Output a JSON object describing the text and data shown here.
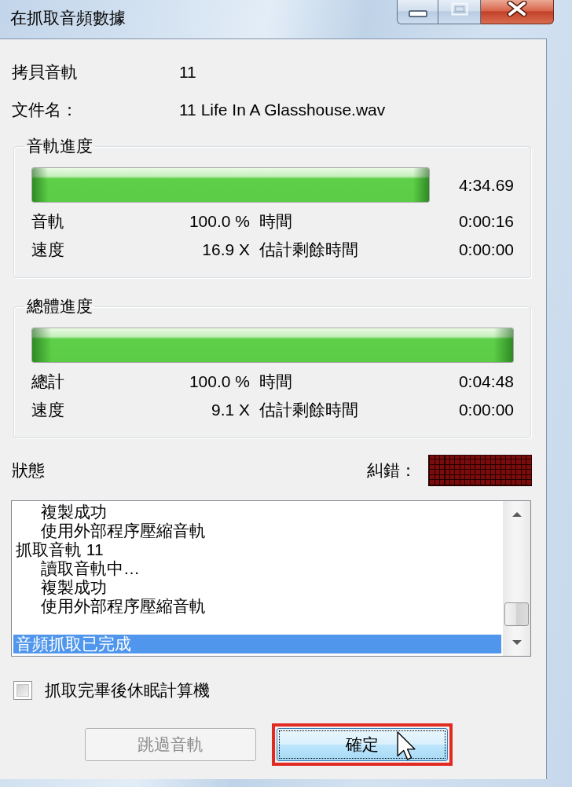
{
  "window": {
    "title": "在抓取音頻數據",
    "buttons": [
      {
        "kind": "minimize",
        "disabled": false
      },
      {
        "kind": "maximize",
        "disabled": true
      },
      {
        "kind": "close",
        "disabled": false
      }
    ]
  },
  "info": [
    {
      "label": "拷貝音軌",
      "value": "11"
    },
    {
      "label": "文件名：",
      "value": "11 Life In A Glasshouse.wav"
    }
  ],
  "progress": [
    {
      "title": "音軌進度",
      "level": 1,
      "reading": "4:34.69",
      "stats": [
        {
          "label": "音軌",
          "value": "100.0 %",
          "label_2": "時間",
          "value_2": "0:00:16"
        },
        {
          "label": "速度",
          "value": "16.9 X",
          "label_2": "估計剩餘時間",
          "value_2": "0:00:00"
        }
      ]
    },
    {
      "title": "總體進度",
      "level": 1,
      "stats": [
        {
          "label": "總計",
          "value": "100.0 %",
          "label_2": "時間",
          "value_2": "0:04:48"
        },
        {
          "label": "速度",
          "value": "9.1 X",
          "label_2": "估計剩餘時間",
          "value_2": "0:00:00"
        }
      ]
    }
  ],
  "status": {
    "label": "狀態",
    "error_label": "糾錯：",
    "log": [
      {
        "kind": "entry",
        "children": [
          {
            "text": "複製成功",
            "selected": false
          },
          {
            "text": "使用外部程序壓縮音軌",
            "selected": false
          }
        ]
      },
      {
        "kind": "entry",
        "text": "抓取音軌 11",
        "selected": false,
        "children": [
          {
            "text": "讀取音軌中…",
            "selected": false
          },
          {
            "text": "複製成功",
            "selected": false
          },
          {
            "text": "使用外部程序壓縮音軌",
            "selected": false
          }
        ]
      },
      {
        "kind": "blank"
      },
      {
        "kind": "entry",
        "text": "音頻抓取已完成",
        "selected": true
      }
    ]
  },
  "checkbox": {
    "label": "抓取完畢後休眠計算機",
    "checked": false
  },
  "buttons": [
    {
      "label": "跳過音軌",
      "disabled": true,
      "default": false,
      "highlighted": false
    },
    {
      "label": "確定",
      "disabled": false,
      "default": true,
      "highlighted": true
    }
  ]
}
